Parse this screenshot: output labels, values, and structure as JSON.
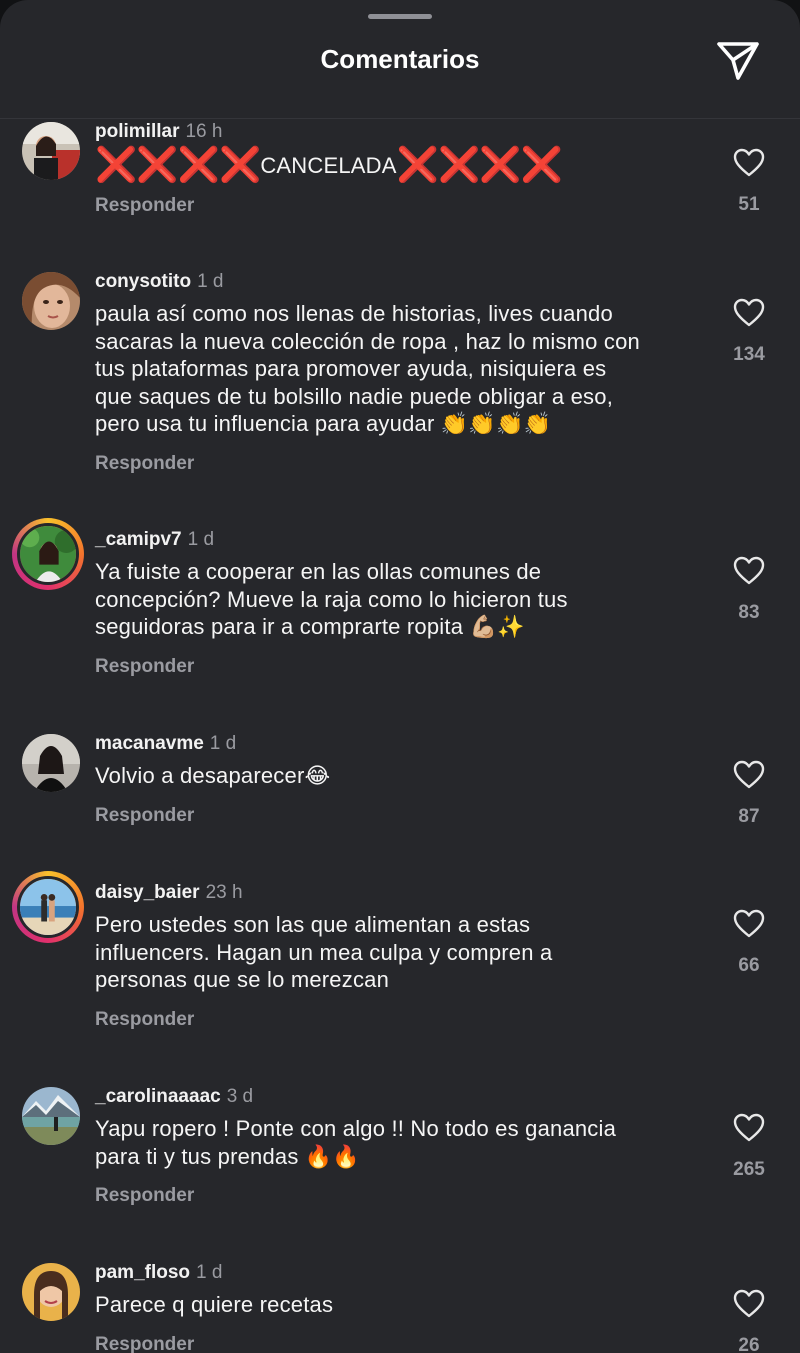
{
  "header": {
    "title": "Comentarios"
  },
  "reply_label": "Responder",
  "colors": {
    "background": "#26272b",
    "muted": "#9a9ba1",
    "accent_red": "#e0262b"
  },
  "comments": [
    {
      "username": "polimillar",
      "time": "16 h",
      "text_prefix": "❌❌❌❌",
      "text_main": "CANCELADA",
      "text_suffix": "❌❌❌❌",
      "likes": "51",
      "avatar_icon": "avatar-photo-icon"
    },
    {
      "username": "conysotito",
      "time": "1 d",
      "text": "paula así como nos llenas de historias, lives cuando\nsacaras la nueva colección de ropa , haz lo mismo con\ntus plataformas para promover ayuda, nisiquiera es\nque saques de tu bolsillo nadie puede obligar a eso,\npero usa tu influencia para ayudar 👏👏👏👏",
      "likes": "134",
      "avatar_icon": "avatar-photo-icon"
    },
    {
      "username": "_camipv7",
      "time": "1 d",
      "text": "Ya fuiste a cooperar en las ollas comunes de\nconcepción? Mueve la raja como lo hicieron tus\nseguidoras para ir a comprarte ropita 💪🏼✨",
      "likes": "83",
      "avatar_icon": "avatar-photo-icon"
    },
    {
      "username": "macanavme",
      "time": "1 d",
      "text": "Volvio a desaparecer😂",
      "likes": "87",
      "avatar_icon": "avatar-photo-icon"
    },
    {
      "username": "daisy_baier",
      "time": "23 h",
      "text": "Pero ustedes son las que alimentan a estas\ninfluencers. Hagan un mea culpa y compren a\npersonas que se lo merezcan",
      "likes": "66",
      "avatar_icon": "avatar-photo-icon"
    },
    {
      "username": "_carolinaaaac",
      "time": "3 d",
      "text": "Yapu ropero ! Ponte con algo !! No todo es ganancia\npara ti y tus prendas 🔥🔥",
      "likes": "265",
      "avatar_icon": "avatar-photo-icon"
    },
    {
      "username": "pam_floso",
      "time": "1 d",
      "text": "Parece q quiere recetas",
      "likes": "26",
      "avatar_icon": "avatar-photo-icon"
    }
  ]
}
